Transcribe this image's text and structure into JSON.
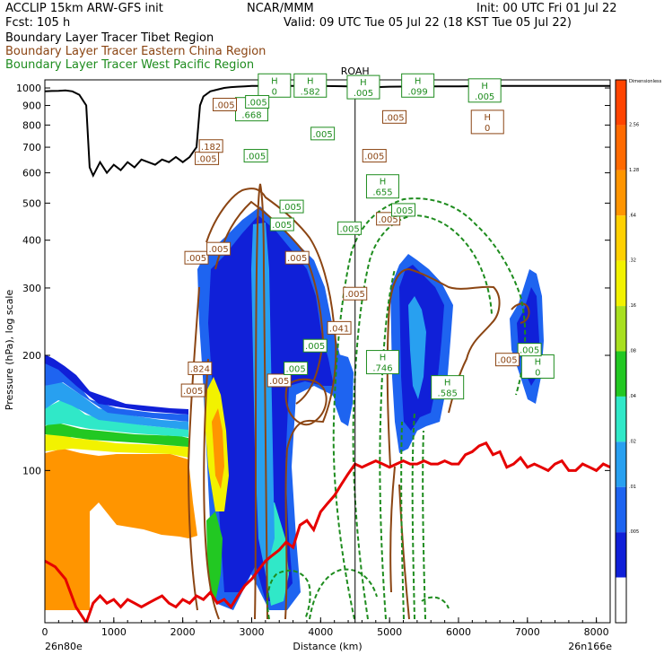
{
  "header": {
    "title_left": "ACCLIP 15km ARW-GFS init",
    "title_center": "NCAR/MMM",
    "init": "Init: 00 UTC Fri 01 Jul 22",
    "fcst": "Fcst:  105 h",
    "valid": "Valid: 09 UTC Tue 05 Jul 22 (18 KST Tue 05 Jul 22)"
  },
  "legend": [
    {
      "label": "Boundary Layer Tracer  Tibet Region",
      "color": "#000000"
    },
    {
      "label": "Boundary Layer Tracer  Eastern China Region",
      "color": "#8B4513"
    },
    {
      "label": "Boundary Layer Tracer  West Pacific Region",
      "color": "#1E8C1E"
    }
  ],
  "colors": {
    "tropopause": "#E60000",
    "terrain": "#000000",
    "brown": "#8B4513",
    "green": "#1E8C1E"
  },
  "chart_data": {
    "type": "area",
    "xlabel": "Distance (km)",
    "ylabel": "Pressure (hPa), log scale",
    "x_start_label": "26n80e",
    "x_end_label": "26n166e",
    "marker_label": "ROAH",
    "marker_x": 4500,
    "xlim": [
      0,
      8200
    ],
    "ylim": [
      1050,
      40
    ],
    "log_y": true,
    "x_ticks": [
      0,
      1000,
      2000,
      3000,
      4000,
      5000,
      6000,
      7000,
      8000
    ],
    "y_ticks": [
      100,
      200,
      300,
      400,
      500,
      600,
      700,
      800,
      900,
      1000
    ],
    "colorbar": {
      "labels": [
        "Dimensionless",
        "2.56",
        "1.28",
        ".64",
        ".32",
        ".16",
        ".08",
        ".04",
        ".02",
        ".01",
        ".005"
      ],
      "colors": [
        "#FF4400",
        "#FF6A00",
        "#FF9500",
        "#FFD000",
        "#F2F200",
        "#A8E020",
        "#22C822",
        "#30E8C8",
        "#28A0F0",
        "#1E64F0",
        "#1020D8",
        "#ffffff"
      ]
    },
    "tropopause": {
      "x": [
        0,
        150,
        300,
        450,
        600,
        700,
        800,
        900,
        1000,
        1100,
        1200,
        1300,
        1400,
        1500,
        1600,
        1700,
        1800,
        1900,
        2000,
        2100,
        2200,
        2300,
        2400,
        2500,
        2600,
        2700,
        2800,
        2900,
        3000,
        3100,
        3200,
        3300,
        3400,
        3500,
        3600,
        3700,
        3800,
        3900,
        4000,
        4100,
        4200,
        4300,
        4400,
        4500,
        4600,
        4700,
        4800,
        4900,
        5000,
        5100,
        5200,
        5300,
        5400,
        5500,
        5600,
        5700,
        5800,
        5900,
        6000,
        6100,
        6200,
        6300,
        6400,
        6500,
        6600,
        6700,
        6800,
        6900,
        7000,
        7100,
        7200,
        7300,
        7400,
        7500,
        7600,
        7700,
        7800,
        7900,
        8000,
        8100,
        8200
      ],
      "p": [
        58,
        56,
        52,
        44,
        40,
        45,
        47,
        45,
        46,
        44,
        46,
        45,
        44,
        45,
        46,
        47,
        45,
        44,
        46,
        45,
        47,
        46,
        48,
        45,
        46,
        44,
        47,
        50,
        52,
        55,
        58,
        60,
        62,
        65,
        63,
        72,
        74,
        70,
        78,
        82,
        86,
        92,
        98,
        104,
        102,
        104,
        106,
        104,
        102,
        104,
        106,
        104,
        104,
        106,
        104,
        104,
        106,
        104,
        104,
        110,
        112,
        116,
        118,
        110,
        112,
        102,
        104,
        108,
        102,
        104,
        102,
        100,
        104,
        106,
        100,
        100,
        104,
        102,
        100,
        104,
        102
      ]
    },
    "terrain": {
      "x": [
        0,
        100,
        200,
        300,
        400,
        500,
        600,
        650,
        700,
        800,
        900,
        1000,
        1100,
        1200,
        1300,
        1400,
        1500,
        1600,
        1700,
        1800,
        1900,
        2000,
        2100,
        2150,
        2200,
        2250,
        2300,
        2400,
        2500,
        2600,
        2700,
        2800,
        2900,
        3000,
        3100,
        3200,
        3400,
        3600,
        3800,
        4000,
        4200,
        4400,
        4600,
        4800,
        5000,
        5500,
        6000,
        6500,
        7000,
        7500,
        8000,
        8200
      ],
      "p": [
        980,
        982,
        983,
        985,
        980,
        960,
        900,
        620,
        590,
        640,
        600,
        630,
        610,
        640,
        620,
        650,
        640,
        630,
        650,
        640,
        660,
        640,
        660,
        680,
        700,
        900,
        950,
        980,
        990,
        1000,
        1005,
        1008,
        1010,
        1012,
        1012,
        1012,
        1012,
        1012,
        1012,
        1012,
        1011,
        1010,
        1008,
        1005,
        1008,
        1010,
        1010,
        1012,
        1012,
        1012,
        1012,
        1012
      ]
    },
    "h_labels": [
      {
        "x": 4900,
        "p": 192,
        "top": "H",
        "bottom": ".746",
        "color": "green"
      },
      {
        "x": 5840,
        "p": 165,
        "top": "H",
        "bottom": ".585",
        "color": "green"
      },
      {
        "x": 7150,
        "p": 187,
        "top": "H",
        "bottom": "0",
        "color": "green"
      },
      {
        "x": 4900,
        "p": 553,
        "top": "H",
        "bottom": ".655",
        "color": "green"
      },
      {
        "x": 6420,
        "p": 815,
        "top": "H",
        "bottom": "0",
        "color": "brown"
      },
      {
        "x": 6380,
        "p": 985,
        "top": "H",
        "bottom": ".005",
        "color": "green"
      },
      {
        "x": 5410,
        "p": 1015,
        "top": "H",
        "bottom": ".099",
        "color": "green"
      },
      {
        "x": 4620,
        "p": 1005,
        "top": "H",
        "bottom": ".005",
        "color": "green"
      },
      {
        "x": 3850,
        "p": 1015,
        "top": "H",
        "bottom": ".582",
        "color": "green"
      },
      {
        "x": 3330,
        "p": 1015,
        "top": "H",
        "bottom": "0",
        "color": "green"
      },
      {
        "x": 3000,
        "p": 880,
        "top": "H",
        "bottom": ".668",
        "color": "green"
      }
    ],
    "value_labels": [
      {
        "x": 2150,
        "p": 162,
        "text": ".005",
        "color": "brown"
      },
      {
        "x": 2250,
        "p": 185,
        "text": ".824",
        "color": "brown"
      },
      {
        "x": 3400,
        "p": 172,
        "text": ".005",
        "color": "brown"
      },
      {
        "x": 3640,
        "p": 185,
        "text": ".005",
        "color": "green"
      },
      {
        "x": 3920,
        "p": 212,
        "text": ".005",
        "color": "green"
      },
      {
        "x": 4270,
        "p": 236,
        "text": ".041",
        "color": "brown"
      },
      {
        "x": 4500,
        "p": 290,
        "text": ".005",
        "color": "brown"
      },
      {
        "x": 7030,
        "p": 207,
        "text": ".005",
        "color": "green"
      },
      {
        "x": 6710,
        "p": 195,
        "text": ".005",
        "color": "brown"
      },
      {
        "x": 2200,
        "p": 360,
        "text": ".005",
        "color": "brown"
      },
      {
        "x": 2520,
        "p": 380,
        "text": ".005",
        "color": "brown"
      },
      {
        "x": 3660,
        "p": 360,
        "text": ".005",
        "color": "brown"
      },
      {
        "x": 3440,
        "p": 440,
        "text": ".005",
        "color": "green"
      },
      {
        "x": 3580,
        "p": 490,
        "text": ".005",
        "color": "green"
      },
      {
        "x": 4420,
        "p": 430,
        "text": ".005",
        "color": "green"
      },
      {
        "x": 4980,
        "p": 455,
        "text": ".005",
        "color": "brown"
      },
      {
        "x": 5200,
        "p": 480,
        "text": ".005",
        "color": "green"
      },
      {
        "x": 2350,
        "p": 655,
        "text": ".005",
        "color": "brown"
      },
      {
        "x": 2410,
        "p": 705,
        "text": ".182",
        "color": "brown"
      },
      {
        "x": 3060,
        "p": 665,
        "text": ".005",
        "color": "green"
      },
      {
        "x": 4030,
        "p": 760,
        "text": ".005",
        "color": "green"
      },
      {
        "x": 4780,
        "p": 665,
        "text": ".005",
        "color": "brown"
      },
      {
        "x": 5070,
        "p": 840,
        "text": ".005",
        "color": "brown"
      },
      {
        "x": 2610,
        "p": 905,
        "text": ".005",
        "color": "brown"
      },
      {
        "x": 3080,
        "p": 920,
        "text": ".005",
        "color": "green"
      }
    ]
  }
}
